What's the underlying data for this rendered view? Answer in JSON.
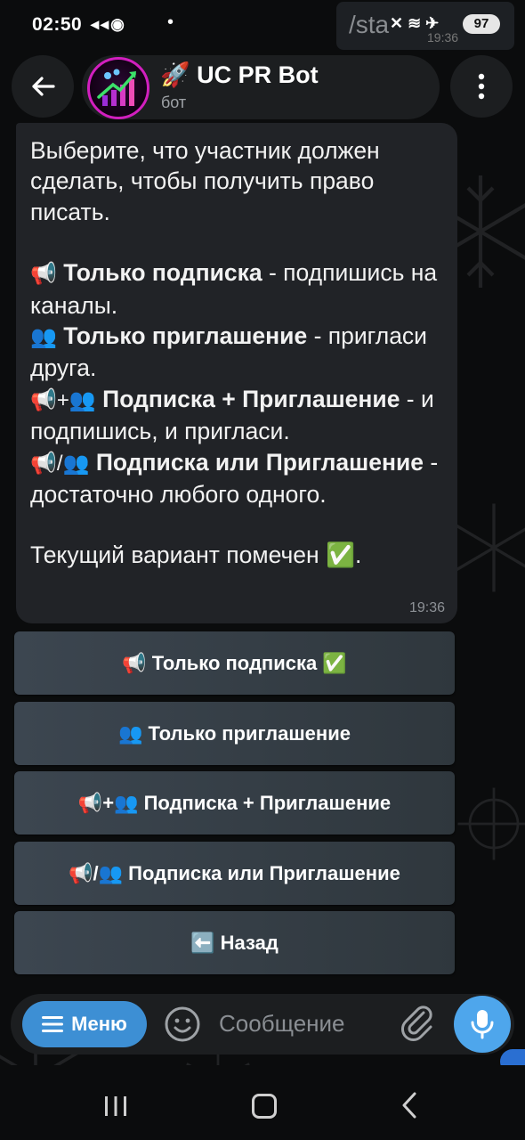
{
  "status_bar": {
    "time": "02:50",
    "left_icons": "◂◂◉",
    "dot": "•",
    "battery": "97",
    "right_icons": "✕ ≋ ✈",
    "background_command": "/sta",
    "background_time": "19:36"
  },
  "header": {
    "back_icon": "arrow-left-icon",
    "bot_name": "🚀 UC PR Bot",
    "bot_subtitle": "бот",
    "menu_icon": "more-vertical-icon",
    "avatar_accent": "#d21fbf"
  },
  "message": {
    "intro": "Выберите, что участник должен сделать, чтобы получить право писать.",
    "options": [
      {
        "emoji": "📢",
        "title": "Только подписка",
        "desc": " - подпишись на каналы."
      },
      {
        "emoji": "👥",
        "title": "Только приглашение",
        "desc": " - пригласи друга."
      },
      {
        "emoji": "📢+👥",
        "title": "Подписка + Приглашение",
        "desc": " - и подпишись, и пригласи."
      },
      {
        "emoji": "📢/👥",
        "title": "Подписка или Приглашение",
        "desc": " - достаточно любого одного."
      }
    ],
    "footer_text": "Текущий вариант помечен ✅.",
    "time": "19:36"
  },
  "keyboard": [
    {
      "label": "📢 Только подписка ✅"
    },
    {
      "label": "👥 Только приглашение"
    },
    {
      "label": "📢+👥 Подписка + Приглашение"
    },
    {
      "label": "📢/👥 Подписка или Приглашение"
    },
    {
      "label": "⬅️ Назад"
    }
  ],
  "input_bar": {
    "menu_label": "Меню",
    "placeholder": "Сообщение",
    "emoji_icon": "smiley-icon",
    "attach_icon": "paperclip-icon",
    "mic_icon": "microphone-icon"
  },
  "colors": {
    "accent": "#3d8fd4",
    "mic": "#4ea6ec",
    "bubble": "#212327"
  }
}
